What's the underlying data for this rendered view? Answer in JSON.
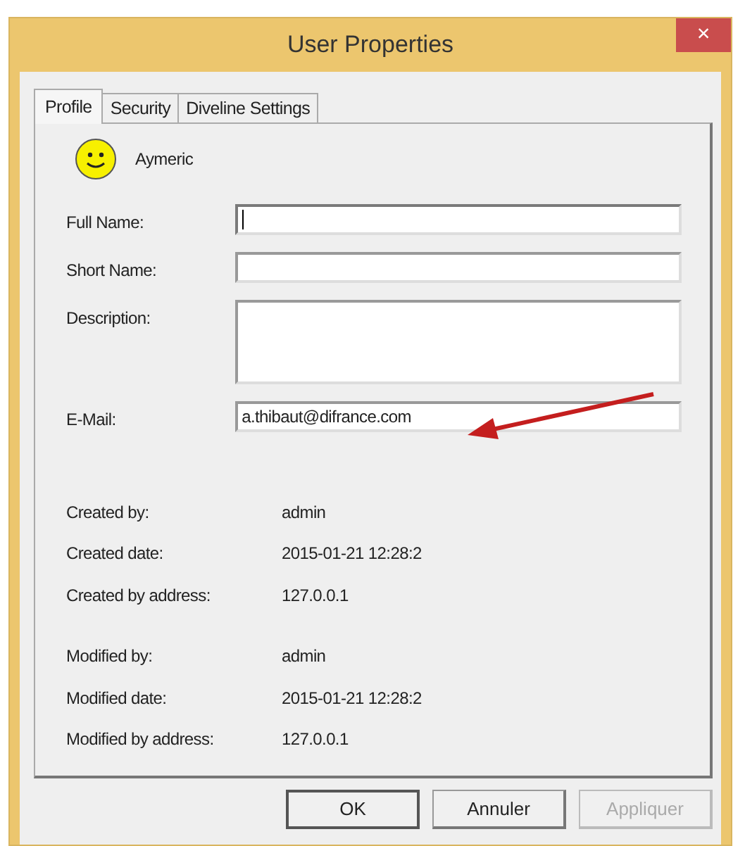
{
  "window": {
    "title": "User Properties",
    "close": "×"
  },
  "tabs": [
    {
      "label": "Profile",
      "selected": true
    },
    {
      "label": "Security",
      "selected": false
    },
    {
      "label": "Diveline Settings",
      "selected": false
    }
  ],
  "user": {
    "name": "Aymeric"
  },
  "fields": [
    {
      "label": "Full Name:",
      "multiline": false,
      "focused": true
    },
    {
      "label": "Short Name:",
      "multiline": false,
      "focused": false
    },
    {
      "label": "Description:",
      "multiline": true,
      "focused": false
    },
    {
      "label": "E-Mail:",
      "value": "a.thibaut@difrance.com",
      "multiline": false,
      "focused": false
    }
  ],
  "info_groups": [
    [
      {
        "label": "Created by:",
        "value": "admin"
      },
      {
        "label": "Created date:",
        "value": "2015-01-21 12:28:2"
      },
      {
        "label": "Created by address:",
        "value": "127.0.0.1"
      }
    ],
    [
      {
        "label": "Modified by:",
        "value": "admin"
      },
      {
        "label": "Modified date:",
        "value": "2015-01-21 12:28:2"
      },
      {
        "label": "Modified by address:",
        "value": "127.0.0.1"
      }
    ]
  ],
  "buttons": [
    {
      "label": "OK",
      "default": true,
      "disabled": false
    },
    {
      "label": "Annuler",
      "default": false,
      "disabled": false
    },
    {
      "label": "Appliquer",
      "default": false,
      "disabled": true
    }
  ]
}
